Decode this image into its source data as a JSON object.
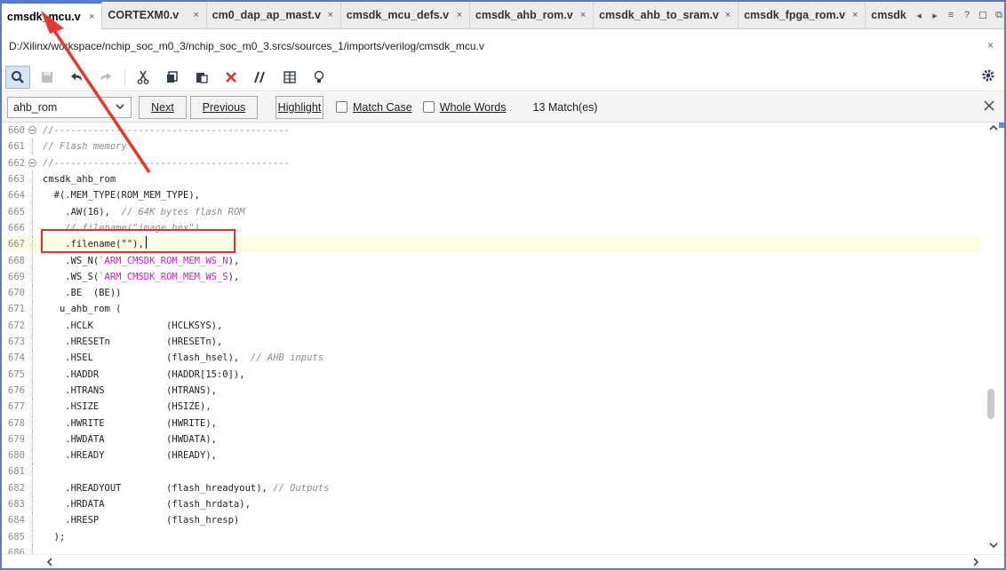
{
  "tabs": [
    {
      "label": "cmsdk_mcu.v",
      "active": true
    },
    {
      "label": "CORTEXM0.v"
    },
    {
      "label": "cm0_dap_ap_mast.v"
    },
    {
      "label": "cmsdk_mcu_defs.v"
    },
    {
      "label": "cmsdk_ahb_rom.v"
    },
    {
      "label": "cmsdk_ahb_to_sram.v"
    },
    {
      "label": "cmsdk_fpga_rom.v"
    },
    {
      "label": "cmsdk"
    }
  ],
  "tab_close": "×",
  "tab_nav": {
    "prev": "◂",
    "next": "▸",
    "menu": "≡",
    "help": "?",
    "restore": "☐",
    "float": "⧉"
  },
  "file_path": "D:/Xilinx/workspace/nchip_soc_m0_3/nchip_soc_m0_3.srcs/sources_1/imports/verilog/cmsdk_mcu.v",
  "path_close": "×",
  "find": {
    "query": "ahb_rom",
    "next_label": "Next",
    "previous_label": "Previous",
    "highlight_label": "Highlight",
    "match_case_label": "Match Case",
    "whole_words_label": "Whole Words",
    "match_count": "13 Match(es)"
  },
  "code_lines": [
    {
      "n": "660",
      "fold": "minus",
      "segs": [
        {
          "t": "//------------------------------------------",
          "c": "com"
        }
      ]
    },
    {
      "n": "661",
      "segs": [
        {
          "t": "// Flash memory",
          "c": "com"
        }
      ]
    },
    {
      "n": "662",
      "fold": "minus",
      "segs": [
        {
          "t": "//------------------------------------------",
          "c": "com"
        }
      ]
    },
    {
      "n": "663",
      "segs": [
        {
          "t": "cmsdk_ahb_rom"
        }
      ]
    },
    {
      "n": "664",
      "segs": [
        {
          "t": "  #(.MEM_TYPE(ROM_MEM_TYPE),"
        }
      ]
    },
    {
      "n": "665",
      "segs": [
        {
          "t": "    .AW(16),  "
        },
        {
          "t": "// 64K bytes flash ROM",
          "c": "com"
        }
      ]
    },
    {
      "n": "666",
      "segs": [
        {
          "t": "    // filename(\"image.hex\")",
          "c": "com"
        }
      ]
    },
    {
      "n": "667",
      "current": true,
      "segs": [
        {
          "t": "    .filename(\"\"),"
        }
      ]
    },
    {
      "n": "668",
      "segs": [
        {
          "t": "    .WS_N("
        },
        {
          "t": "`ARM_CMSDK_ROM_MEM_WS_N",
          "c": "mac"
        },
        {
          "t": "),"
        }
      ]
    },
    {
      "n": "669",
      "segs": [
        {
          "t": "    .WS_S("
        },
        {
          "t": "`ARM_CMSDK_ROM_MEM_WS_S",
          "c": "mac"
        },
        {
          "t": "),"
        }
      ]
    },
    {
      "n": "670",
      "segs": [
        {
          "t": "    .BE  (BE))"
        }
      ]
    },
    {
      "n": "671",
      "segs": [
        {
          "t": "   u_ahb_rom ("
        }
      ]
    },
    {
      "n": "672",
      "segs": [
        {
          "t": "    .HCLK             (HCLKSYS),"
        }
      ]
    },
    {
      "n": "673",
      "segs": [
        {
          "t": "    .HRESETn          (HRESETn),"
        }
      ]
    },
    {
      "n": "674",
      "segs": [
        {
          "t": "    .HSEL             (flash_hsel),  "
        },
        {
          "t": "// AHB inputs",
          "c": "com"
        }
      ]
    },
    {
      "n": "675",
      "segs": [
        {
          "t": "    .HADDR            (HADDR[15:0]),"
        }
      ]
    },
    {
      "n": "676",
      "segs": [
        {
          "t": "    .HTRANS           (HTRANS),"
        }
      ]
    },
    {
      "n": "677",
      "segs": [
        {
          "t": "    .HSIZE            (HSIZE),"
        }
      ]
    },
    {
      "n": "678",
      "segs": [
        {
          "t": "    .HWRITE           (HWRITE),"
        }
      ]
    },
    {
      "n": "679",
      "segs": [
        {
          "t": "    .HWDATA           (HWDATA),"
        }
      ]
    },
    {
      "n": "680",
      "segs": [
        {
          "t": "    .HREADY           (HREADY),"
        }
      ]
    },
    {
      "n": "681",
      "segs": [
        {
          "t": ""
        }
      ]
    },
    {
      "n": "682",
      "segs": [
        {
          "t": "    .HREADYOUT        (flash_hreadyout), "
        },
        {
          "t": "// Outputs",
          "c": "com"
        }
      ]
    },
    {
      "n": "683",
      "segs": [
        {
          "t": "    .HRDATA           (flash_hrdata),"
        }
      ]
    },
    {
      "n": "684",
      "segs": [
        {
          "t": "    .HRESP            (flash_hresp)"
        }
      ]
    },
    {
      "n": "685",
      "segs": [
        {
          "t": "  );"
        }
      ]
    },
    {
      "n": "686",
      "segs": [
        {
          "t": ""
        }
      ]
    }
  ],
  "colors": {
    "accent": "#4a7bd0",
    "annotation_red": "#e0312e",
    "macro": "#c026d3",
    "comment": "#8c8c8c",
    "current_line": "#fdfde3"
  }
}
